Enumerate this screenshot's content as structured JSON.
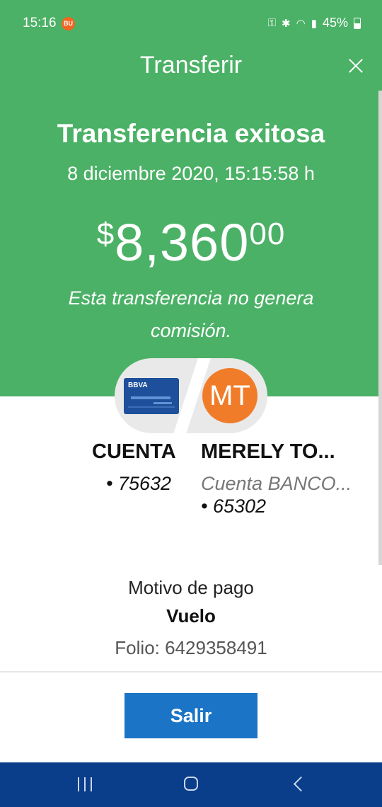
{
  "status_bar": {
    "time": "15:16",
    "notification_icon_label": "BU",
    "battery": "45%",
    "icons": [
      "key-icon",
      "bluetooth-icon",
      "wifi-icon",
      "signal-icon",
      "battery-icon"
    ]
  },
  "header": {
    "title": "Transferir",
    "close_icon": "close-icon"
  },
  "result": {
    "heading": "Transferencia exitosa",
    "date": "8 diciembre 2020, 15:15:58 h",
    "amount_currency": "$",
    "amount_whole": "8,360",
    "amount_cents": "00",
    "fee_note": "Esta transferencia no genera comisión."
  },
  "accounts": {
    "card_brand": "BBVA",
    "recipient_initials": "MT",
    "from_title": "CUENTA",
    "from_number": "• 75632",
    "to_title": "MERELY TO...",
    "to_bank": "Cuenta BANCO...",
    "to_number": "• 65302"
  },
  "details": {
    "reason_label": "Motivo de pago",
    "reason_value": "Vuelo",
    "folio": "Folio: 6429358491"
  },
  "actions": {
    "exit_label": "Salir"
  },
  "colors": {
    "header_green": "#4bb166",
    "button_blue": "#1b74c6",
    "nav_blue": "#0a3d8a",
    "avatar_orange": "#f07c2a"
  }
}
